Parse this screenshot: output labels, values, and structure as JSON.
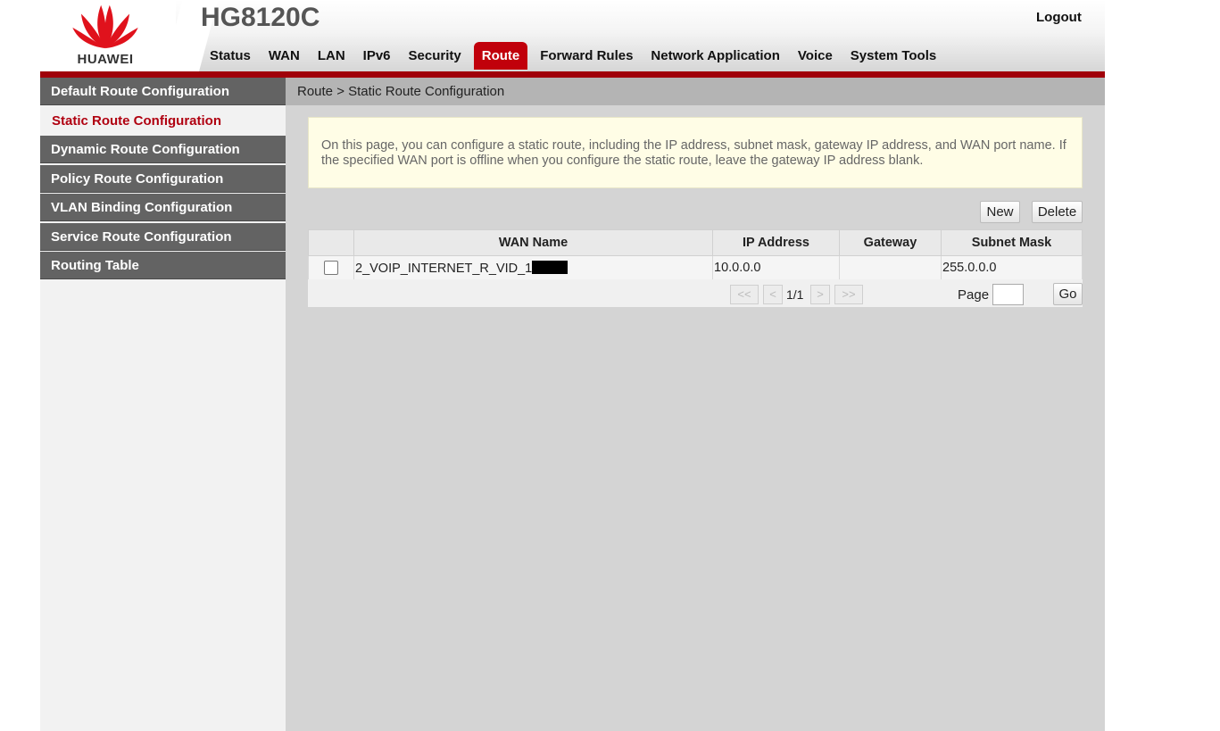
{
  "header": {
    "brand": "HUAWEI",
    "model": "HG8120C",
    "logout": "Logout"
  },
  "nav": [
    "Status",
    "WAN",
    "LAN",
    "IPv6",
    "Security",
    "Route",
    "Forward Rules",
    "Network Application",
    "Voice",
    "System Tools"
  ],
  "nav_active": "Route",
  "sidebar": {
    "items": [
      "Default Route Configuration",
      "Static Route Configuration",
      "Dynamic Route Configuration",
      "Policy Route Configuration",
      "VLAN Binding Configuration",
      "Service Route Configuration",
      "Routing Table"
    ],
    "active": "Static Route Configuration"
  },
  "breadcrumb": "Route > Static Route Configuration",
  "info_text": "On this page, you can configure a static route, including the IP address, subnet mask, gateway IP address, and WAN port name. If the specified WAN port is offline when you configure the static route, leave the gateway IP address blank.",
  "buttons": {
    "new": "New",
    "delete": "Delete"
  },
  "table": {
    "columns": [
      "WAN Name",
      "IP Address",
      "Gateway",
      "Subnet Mask"
    ],
    "rows": [
      {
        "wan_name": "2_VOIP_INTERNET_R_VID_1",
        "ip": "10.0.0.0",
        "gateway": "",
        "mask": "255.0.0.0",
        "checked": false
      }
    ]
  },
  "pager": {
    "first": "<<",
    "prev": "<",
    "status": "1/1",
    "next": ">",
    "last": ">>",
    "page_label": "Page",
    "page_value": "",
    "go": "Go"
  },
  "colors": {
    "accent": "#c1000b",
    "sidebar": "#636363",
    "info_bg": "#fffde6"
  }
}
